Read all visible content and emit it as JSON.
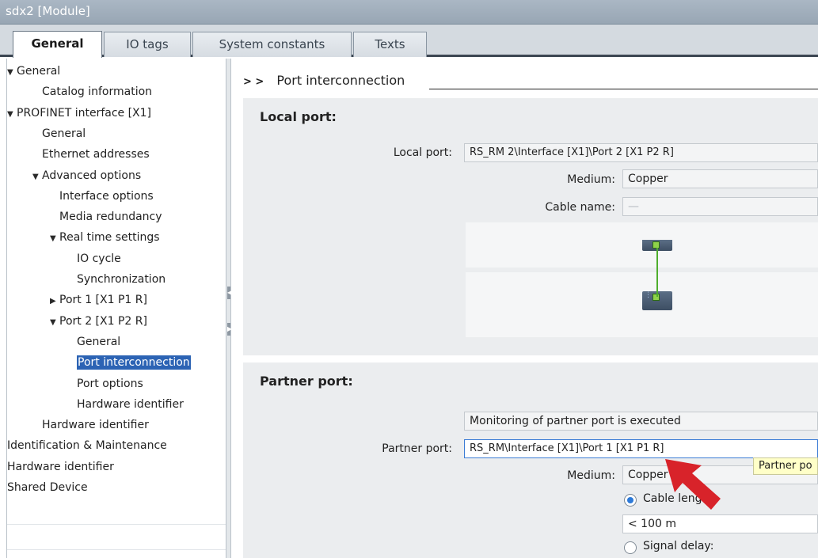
{
  "window": {
    "title": "sdx2 [Module]"
  },
  "tabs": [
    {
      "label": "General",
      "active": true
    },
    {
      "label": "IO tags",
      "active": false
    },
    {
      "label": "System constants",
      "active": false
    },
    {
      "label": "Texts",
      "active": false
    }
  ],
  "nav": {
    "items": [
      {
        "label": "General",
        "level": 0,
        "arrow": "expanded"
      },
      {
        "label": "Catalog information",
        "level": 1,
        "arrow": "none"
      },
      {
        "label": "PROFINET interface [X1]",
        "level": 0,
        "arrow": "expanded"
      },
      {
        "label": "General",
        "level": 1,
        "arrow": "none"
      },
      {
        "label": "Ethernet addresses",
        "level": 1,
        "arrow": "none"
      },
      {
        "label": "Advanced options",
        "level": 1,
        "arrow": "expanded"
      },
      {
        "label": "Interface options",
        "level": 2,
        "arrow": "none"
      },
      {
        "label": "Media redundancy",
        "level": 2,
        "arrow": "none"
      },
      {
        "label": "Real time settings",
        "level": 2,
        "arrow": "expanded"
      },
      {
        "label": "IO cycle",
        "level": 3,
        "arrow": "none"
      },
      {
        "label": "Synchronization",
        "level": 3,
        "arrow": "none"
      },
      {
        "label": "Port 1 [X1 P1 R]",
        "level": 2,
        "arrow": "collapsed"
      },
      {
        "label": "Port 2 [X1 P2 R]",
        "level": 2,
        "arrow": "expanded"
      },
      {
        "label": "General",
        "level": 3,
        "arrow": "none"
      },
      {
        "label": "Port interconnection",
        "level": 3,
        "arrow": "none",
        "selected": true
      },
      {
        "label": "Port options",
        "level": 3,
        "arrow": "none"
      },
      {
        "label": "Hardware identifier",
        "level": 3,
        "arrow": "none"
      },
      {
        "label": "Hardware identifier",
        "level": 1,
        "arrow": "none"
      },
      {
        "label": "Identification & Maintenance",
        "level": 0,
        "arrow": "none"
      },
      {
        "label": "Hardware identifier",
        "level": 0,
        "arrow": "none"
      },
      {
        "label": "Shared Device",
        "level": 0,
        "arrow": "none"
      }
    ]
  },
  "content": {
    "breadcrumb": {
      "chevrons": "> >",
      "title": "Port interconnection"
    },
    "local": {
      "header": "Local port:",
      "local_port_label": "Local port:",
      "local_port_value": "RS_RM 2\\Interface [X1]\\Port 2 [X1 P2 R]",
      "medium_label": "Medium:",
      "medium_value": "Copper",
      "cable_name_label": "Cable name:",
      "cable_name_value": "—"
    },
    "partner": {
      "header": "Partner port:",
      "monitoring_value": "Monitoring of partner port is executed",
      "partner_port_label": "Partner port:",
      "partner_port_value": "RS_RM\\Interface [X1]\\Port 1 [X1 P1 R]",
      "medium_label": "Medium:",
      "medium_value": "Copper",
      "cable_length_label": "Cable length:",
      "cable_length_value": "< 100 m",
      "signal_delay_label": "Signal delay:"
    },
    "tooltip": "Partner po"
  },
  "colors": {
    "titlebar": "#a3b1bf",
    "selection": "#2c63b4",
    "section_bg": "#ebedef",
    "port_green": "#8fd34a",
    "pointer_red": "#d8232a",
    "tooltip_bg": "#ffffc8"
  },
  "icons": {
    "pointer": "red-arrow-pointer-icon",
    "expanded": "triangle-down-icon",
    "collapsed": "triangle-right-icon"
  }
}
